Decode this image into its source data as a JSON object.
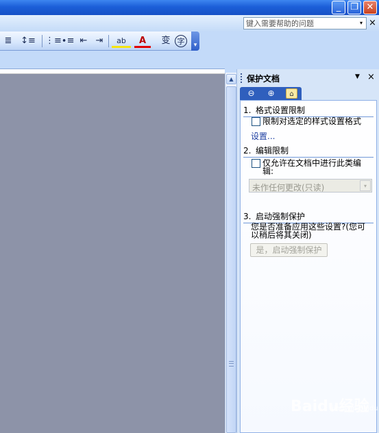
{
  "window": {
    "minimize_glyph": "_",
    "maximize_glyph": "❐",
    "close_glyph": "✕"
  },
  "menubar": {
    "help_placeholder": "键入需要帮助的问题",
    "help_dropdown_glyph": "▾",
    "close_glyph": "×"
  },
  "toolbar": {
    "buttons": [
      {
        "name": "justify-icon",
        "glyph": "≣"
      },
      {
        "name": "line-spacing-icon",
        "glyph": "↕≡"
      },
      {
        "name": "numbered-list-icon",
        "glyph": "⋮≡"
      },
      {
        "name": "bullet-list-icon",
        "glyph": "∙≡"
      },
      {
        "name": "decrease-indent-icon",
        "glyph": "⇤"
      },
      {
        "name": "increase-indent-icon",
        "glyph": "⇥"
      },
      {
        "name": "highlight-icon",
        "glyph": "ab"
      },
      {
        "name": "font-color-icon",
        "glyph": "A"
      },
      {
        "name": "phonetic-guide-icon",
        "glyph": "变"
      },
      {
        "name": "enclose-character-icon",
        "glyph": "字"
      }
    ],
    "options_glyph": "▾"
  },
  "scroll": {
    "up_glyph": "▲"
  },
  "task_pane": {
    "title": "保护文档",
    "dropdown_glyph": "▼",
    "close_glyph": "×",
    "nav_back_glyph": "⊖",
    "nav_forward_glyph": "⊕",
    "nav_home_glyph": "⌂",
    "section1": {
      "number": "1.",
      "title": "格式设置限制",
      "checkbox_label": "限制对选定的样式设置格式",
      "link": "设置..."
    },
    "section2": {
      "number": "2.",
      "title": "编辑限制",
      "checkbox_label_line1": "仅允许在文档中进行此类编",
      "checkbox_label_line2": "辑:",
      "select_value": "未作任何更改(只读)",
      "select_arrow": "▾"
    },
    "section3": {
      "number": "3.",
      "title": "启动强制保护",
      "prompt_line1": "您是否准备应用这些设置?(您可",
      "prompt_line2": "以稍后将其关闭)",
      "button_label": "是，启动强制保护"
    }
  },
  "watermark": {
    "brand": "Baidu经验",
    "url": "jingyan.baidu.com"
  }
}
